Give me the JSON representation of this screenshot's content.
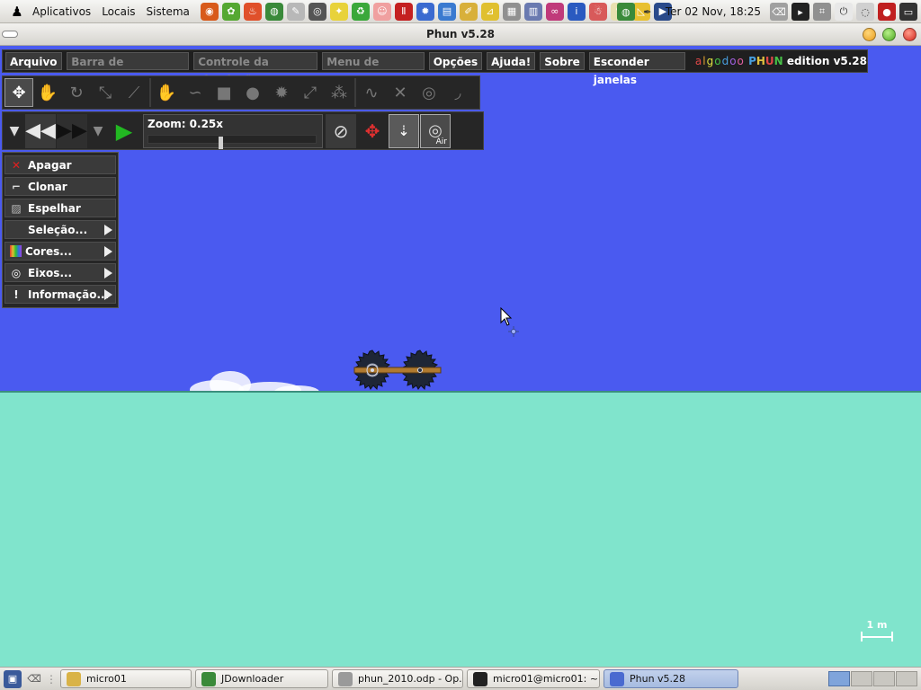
{
  "top_panel": {
    "menus": [
      "Aplicativos",
      "Locais",
      "Sistema"
    ],
    "clock": "Ter 02 Nov, 18:25",
    "launchers": [
      {
        "icon": "camera-icon",
        "color": "#d85a1a",
        "glyph": "◉"
      },
      {
        "icon": "leaf-icon",
        "color": "#55a832",
        "glyph": "✿"
      },
      {
        "icon": "flame-icon",
        "color": "#e0502a",
        "glyph": "♨"
      },
      {
        "icon": "globe-icon",
        "color": "#3a8a3a",
        "glyph": "◍"
      },
      {
        "icon": "paint-icon",
        "color": "#b8b8b8",
        "glyph": "✎"
      },
      {
        "icon": "disc-icon",
        "color": "#555555",
        "glyph": "◎"
      },
      {
        "icon": "spark-icon",
        "color": "#e8d23a",
        "glyph": "✦"
      },
      {
        "icon": "recycle-icon",
        "color": "#3aa83a",
        "glyph": "♻"
      },
      {
        "icon": "pig-icon",
        "color": "#f0a0a0",
        "glyph": "☺"
      },
      {
        "icon": "stop-icon",
        "color": "#c42020",
        "glyph": "Ⅱ"
      },
      {
        "icon": "gear-icon",
        "color": "#3a6ad0",
        "glyph": "✹"
      },
      {
        "icon": "document-icon",
        "color": "#3a7ad0",
        "glyph": "▤"
      },
      {
        "icon": "pencil-icon",
        "color": "#d8b03a",
        "glyph": "✐"
      },
      {
        "icon": "ruler-icon",
        "color": "#e0c030",
        "glyph": "⊿"
      },
      {
        "icon": "keyboard-icon",
        "color": "#909090",
        "glyph": "▦"
      },
      {
        "icon": "chart-icon",
        "color": "#6a7ab0",
        "glyph": "▥"
      },
      {
        "icon": "loop-icon",
        "color": "#c03a7a",
        "glyph": "∞"
      },
      {
        "icon": "info-icon",
        "color": "#2a5ac0",
        "glyph": "i"
      },
      {
        "icon": "figure-icon",
        "color": "#d85a5a",
        "glyph": "☃"
      },
      {
        "icon": "notepad-icon",
        "color": "#e8e0b0",
        "glyph": "✎"
      },
      {
        "icon": "ruler-triangle-icon",
        "color": "#e8c030",
        "glyph": "◺"
      },
      {
        "icon": "film-icon",
        "color": "#2a4a8a",
        "glyph": "▶"
      }
    ],
    "tray": [
      {
        "icon": "globe-tray-icon",
        "color": "#3a8a3a",
        "glyph": "◍"
      },
      {
        "icon": "pen-tray-icon",
        "color": "#555555",
        "glyph": "✒"
      },
      {
        "icon": "trash-tray-icon",
        "color": "#a0a0a0",
        "glyph": "⌫"
      },
      {
        "icon": "terminal-tray-icon",
        "color": "#222222",
        "glyph": "▸"
      },
      {
        "icon": "screenshot-tray-icon",
        "color": "#909090",
        "glyph": "⌗"
      },
      {
        "icon": "power-tray-icon",
        "color": "#e8e8e8",
        "glyph": "⏻"
      },
      {
        "icon": "network-tray-icon",
        "color": "#d0d0d0",
        "glyph": "◌"
      },
      {
        "icon": "record-tray-icon",
        "color": "#c02020",
        "glyph": "●"
      },
      {
        "icon": "monitor-tray-icon",
        "color": "#333333",
        "glyph": "▭"
      }
    ]
  },
  "window": {
    "title": "Phun v5.28"
  },
  "phun_menu": {
    "items": [
      {
        "label": "Arquivo ▾",
        "enabled": true
      },
      {
        "label": "Barra de Ferramentas",
        "enabled": false
      },
      {
        "label": "Controle da simulação",
        "enabled": false
      },
      {
        "label": "Menu de contexto",
        "enabled": false
      },
      {
        "label": "Opções",
        "enabled": true
      },
      {
        "label": "Ajuda!",
        "enabled": true
      },
      {
        "label": "Sobre",
        "enabled": true
      },
      {
        "label": "Esconder janelas",
        "enabled": true
      }
    ],
    "brand_prefix": "algodoo",
    "brand_name": "PHUN",
    "brand_suffix": "edition",
    "brand_version": "v5.28"
  },
  "tools": [
    {
      "name": "move-tool-icon",
      "glyph": "✥",
      "active": true
    },
    {
      "name": "drag-hand-tool-icon",
      "glyph": "✋",
      "active": false
    },
    {
      "name": "rotate-tool-icon",
      "glyph": "↻",
      "active": false
    },
    {
      "name": "scale-tool-icon",
      "glyph": "⤡",
      "active": false
    },
    {
      "name": "knife-tool-icon",
      "glyph": "⟋",
      "active": false
    },
    {
      "sep": true
    },
    {
      "name": "sketch-tool-icon",
      "glyph": "✋",
      "active": false
    },
    {
      "name": "brush-tool-icon",
      "glyph": "∽",
      "active": false
    },
    {
      "name": "box-tool-icon",
      "glyph": "■",
      "active": false
    },
    {
      "name": "circle-tool-icon",
      "glyph": "●",
      "active": false
    },
    {
      "name": "gear-tool-icon",
      "glyph": "✹",
      "active": false
    },
    {
      "name": "plane-tool-icon",
      "glyph": "⤢",
      "active": false
    },
    {
      "name": "chain-tool-icon",
      "glyph": "⁂",
      "active": false
    },
    {
      "sep": true
    },
    {
      "name": "spring-tool-icon",
      "glyph": "∿",
      "active": false
    },
    {
      "name": "fixate-tool-icon",
      "glyph": "✕",
      "active": false
    },
    {
      "name": "axle-tool-icon",
      "glyph": "◎",
      "active": false
    },
    {
      "name": "tracer-tool-icon",
      "glyph": "◞",
      "active": false
    }
  ],
  "simulation": {
    "zoom_label": "Zoom: 0.25x",
    "zoom_fraction": 0.42,
    "air_label": "Air"
  },
  "context_menu": {
    "items": [
      {
        "label": "Apagar",
        "icon": "delete-icon",
        "glyph": "✕",
        "color": "#e02020",
        "submenu": false
      },
      {
        "label": "Clonar",
        "icon": "clone-icon",
        "glyph": "⌐",
        "color": "#dddddd",
        "submenu": false
      },
      {
        "label": "Espelhar",
        "icon": "mirror-icon",
        "glyph": "▨",
        "color": "#bbbbbb",
        "submenu": false
      },
      {
        "label": "Seleção...",
        "icon": "",
        "glyph": "",
        "color": "#ffffff",
        "submenu": true
      },
      {
        "label": "Cores...",
        "icon": "colors-icon",
        "glyph": "▌",
        "color": "#e0a020",
        "submenu": true
      },
      {
        "label": "Eixos...",
        "icon": "axis-icon",
        "glyph": "◎",
        "color": "#ffffff",
        "submenu": true
      },
      {
        "label": "Informação...",
        "icon": "info-icon",
        "glyph": "!",
        "color": "#ffffff",
        "submenu": true
      }
    ]
  },
  "scene": {
    "sky_color": "#4a5af0",
    "ground_color": "#80e4cc",
    "scale_label": "1 m"
  },
  "taskbar": {
    "tasks": [
      {
        "label": "micro01",
        "icon": "folder-icon",
        "color": "#d9b347",
        "width": 146,
        "active": false
      },
      {
        "label": "JDownloader",
        "icon": "jdownloader-icon",
        "color": "#3a8a3a",
        "width": 148,
        "active": false
      },
      {
        "label": "phun_2010.odp - Op...",
        "icon": "presentation-icon",
        "color": "#9a9a9a",
        "width": 146,
        "active": false
      },
      {
        "label": "micro01@micro01: ~",
        "icon": "terminal-icon",
        "color": "#222222",
        "width": 148,
        "active": false
      },
      {
        "label": "Phun v5.28",
        "icon": "phun-icon",
        "color": "#4a6ad0",
        "width": 150,
        "active": true
      }
    ],
    "workspaces": 4,
    "active_workspace": 0
  }
}
